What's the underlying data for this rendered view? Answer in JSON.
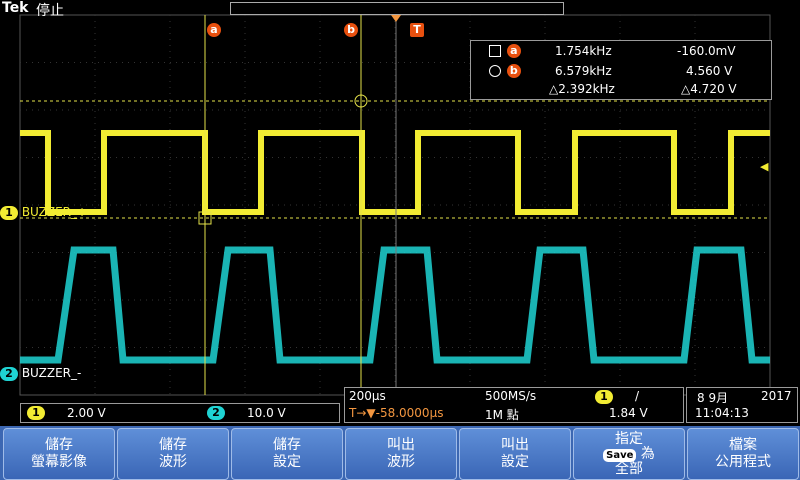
{
  "header": {
    "brand": "Tek",
    "status": "停止"
  },
  "markers": {
    "a": "a",
    "b": "b",
    "trigger": "T"
  },
  "cursor_readout": {
    "rows": [
      {
        "label": "a",
        "freq": "1.754kHz",
        "volt": "-160.0mV"
      },
      {
        "label": "b",
        "freq": "6.579kHz",
        "volt": "4.560 V"
      }
    ],
    "delta_freq": "△2.392kHz",
    "delta_volt": "△4.720 V"
  },
  "channels": {
    "ch1": {
      "num": "1",
      "label": "BUZZER_+",
      "scale": "2.00 V",
      "color": "#f2ec33"
    },
    "ch2": {
      "num": "2",
      "label": "BUZZER_-",
      "scale": "10.0 V",
      "color": "#1fd3d3"
    }
  },
  "timebase": {
    "time_div": "200µs",
    "sample_rate": "500MS/s",
    "trigger_pos": "T→▼-58.0000µs",
    "record": "1M 點"
  },
  "trigger": {
    "source": "1",
    "slope": "/",
    "level": "1.84 V"
  },
  "datetime": {
    "date": "8 9月",
    "year": "2017",
    "time": "11:04:13"
  },
  "menu": [
    {
      "line1": "儲存",
      "line2": "螢幕影像"
    },
    {
      "line1": "儲存",
      "line2": "波形"
    },
    {
      "line1": "儲存",
      "line2": "設定"
    },
    {
      "line1": "叫出",
      "line2": "波形"
    },
    {
      "line1": "叫出",
      "line2": "設定"
    },
    {
      "line1": "指定",
      "save": "Save",
      "line2a": "為",
      "line2": "全部"
    },
    {
      "line1": "檔案",
      "line2": "公用程式"
    }
  ]
}
